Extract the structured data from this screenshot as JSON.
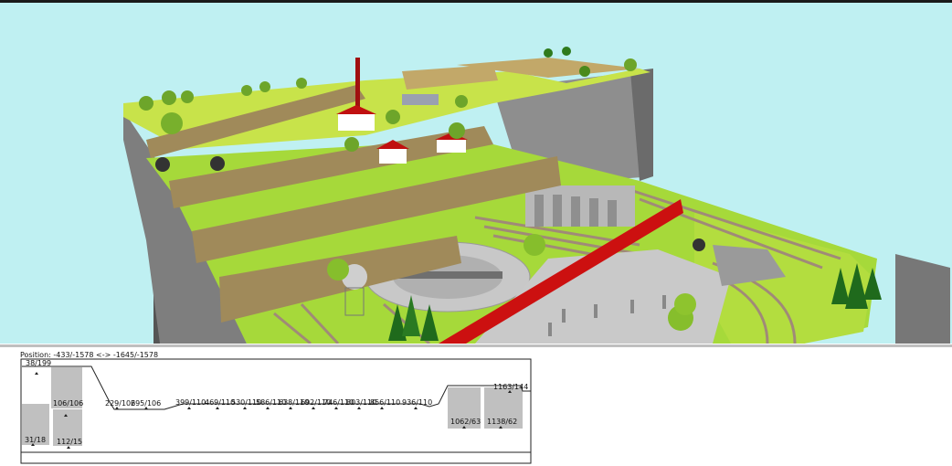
{
  "viewport3d": {
    "sky_color": "#bff0f2",
    "description_icon": "layout-3d-view"
  },
  "profile": {
    "position_label": "Position: -433/-1578 <-> -1645/-1578",
    "labels": [
      {
        "text": "38/199"
      },
      {
        "text": "31/18"
      },
      {
        "text": "106/106"
      },
      {
        "text": "112/15"
      },
      {
        "text": "229/106"
      },
      {
        "text": "295/106"
      },
      {
        "text": "399/110"
      },
      {
        "text": "469/110"
      },
      {
        "text": "530/110"
      },
      {
        "text": "586/110"
      },
      {
        "text": "638/110"
      },
      {
        "text": "692/110"
      },
      {
        "text": "746/110"
      },
      {
        "text": "803/110"
      },
      {
        "text": "856/110"
      },
      {
        "text": "936/110"
      },
      {
        "text": "1062/63"
      },
      {
        "text": "1138/62"
      },
      {
        "text": "1163/144"
      }
    ]
  }
}
